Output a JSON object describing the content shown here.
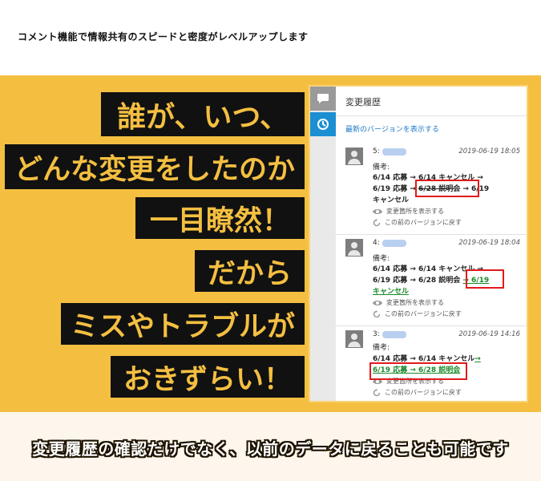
{
  "top_caption": "コメント機能で情報共有のスピードと密度がレベルアップします",
  "headline": [
    "誰が、いつ、",
    "どんな変更をしたのか",
    "一目瞭然！",
    "だから",
    "ミスやトラブルが",
    "おきずらい！"
  ],
  "panel": {
    "title": "変更履歴",
    "latest_link": "最新のバージョンを表示する",
    "entries": [
      {
        "num": "5:",
        "timestamp": "2019-06-19 18:05",
        "note_label": "備考:",
        "line1": "6/14 応募 → 6/14 キャンセル →",
        "line2_a": "6/19 応募 → ",
        "line2_b": "6/28 説明会",
        "line2_c": " → 6/19",
        "line3": "キャンセル",
        "show_changes": "変更箇所を表示する",
        "revert": "この前のバージョンに戻す"
      },
      {
        "num": "4:",
        "timestamp": "2019-06-19 18:04",
        "note_label": "備考:",
        "line1": "6/14 応募 → 6/14 キャンセル →",
        "line2_a": "6/19 応募 → 6/28 説明会 ",
        "line2_b": "→ 6/19",
        "line3": "キャンセル",
        "show_changes": "変更箇所を表示する",
        "revert": "この前のバージョンに戻す"
      },
      {
        "num": "3:",
        "timestamp": "2019-06-19 14:16",
        "note_label": "備考:",
        "line1_a": "6/14 応募 → 6/14 キャンセル",
        "line1_b": "→",
        "line2": "6/19 応募 → 6/28 説明会",
        "show_changes": "変更箇所を表示する",
        "revert": "この前のバージョンに戻す"
      }
    ]
  },
  "bottom_caption": "変更履歴の確認だけでなく、以前のデータに戻ることも可能です",
  "colors": {
    "yellow": "#f4bf41",
    "headline_bg": "#111111",
    "highlight_box": "#e11b1b",
    "added_text": "#1a8a2a",
    "link": "#1f79c8",
    "history_tab": "#1c8fd3"
  },
  "icons": [
    "comment-icon",
    "history-icon",
    "user-avatar-icon",
    "eye-icon",
    "revert-icon"
  ]
}
